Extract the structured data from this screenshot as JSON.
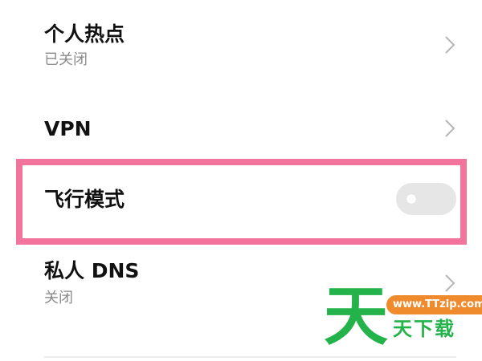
{
  "settings": {
    "hotspot": {
      "title": "个人热点",
      "status": "已关闭"
    },
    "vpn": {
      "title": "VPN"
    },
    "airplane_mode": {
      "title": "飞行模式",
      "enabled": false
    },
    "private_dns": {
      "title": "私人 DNS",
      "status": "关闭"
    }
  },
  "watermark": {
    "logo_char": "天",
    "url": "www.TTzip.com",
    "text": "天下载"
  },
  "colors": {
    "highlight_border": "#f2739b",
    "toggle_off": "#e6e6e6",
    "watermark_green": "#24b34a",
    "watermark_orange": "#f08b2d"
  },
  "icons": {
    "chevron": "chevron-right-icon"
  }
}
